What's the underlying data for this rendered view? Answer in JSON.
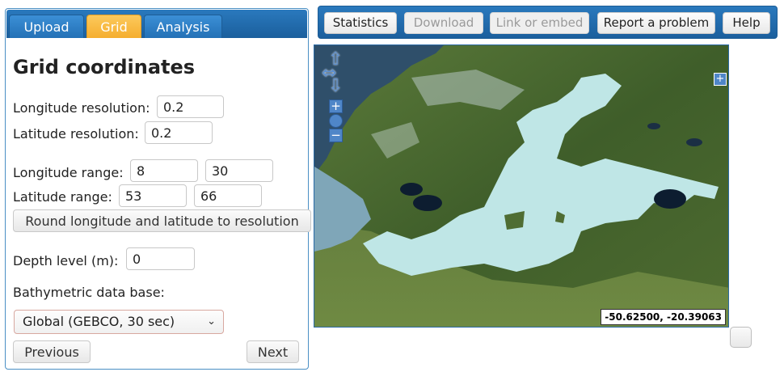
{
  "tabs": [
    {
      "label": "Upload"
    },
    {
      "label": "Grid"
    },
    {
      "label": "Analysis"
    }
  ],
  "panel": {
    "title": "Grid coordinates",
    "lon_res_label": "Longitude resolution:",
    "lon_res_value": "0.2",
    "lat_res_label": "Latitude resolution:",
    "lat_res_value": "0.2",
    "lon_range_label": "Longitude range:",
    "lon_min": "8",
    "lon_max": "30",
    "lat_range_label": "Latitude range:",
    "lat_min": "53",
    "lat_max": "66",
    "round_button": "Round longitude and latitude to resolution",
    "depth_label": "Depth level (m):",
    "depth_value": "0",
    "bathy_label": "Bathymetric data base:",
    "bathy_selected": "Global (GEBCO, 30 sec)",
    "prev_button": "Previous",
    "next_button": "Next"
  },
  "toolbar": {
    "statistics": "Statistics",
    "download": "Download",
    "link_embed": "Link or embed",
    "report": "Report a problem",
    "help": "Help"
  },
  "map": {
    "coordinates": "-50.62500, -20.39063",
    "zoom_in": "+",
    "zoom_out": "−",
    "layer_switcher": "+"
  },
  "colors": {
    "accent_blue": "#1b5f9d",
    "active_tab": "#f5ae2f",
    "sea": "#bfe6e6",
    "land": "#4b6a2e"
  }
}
